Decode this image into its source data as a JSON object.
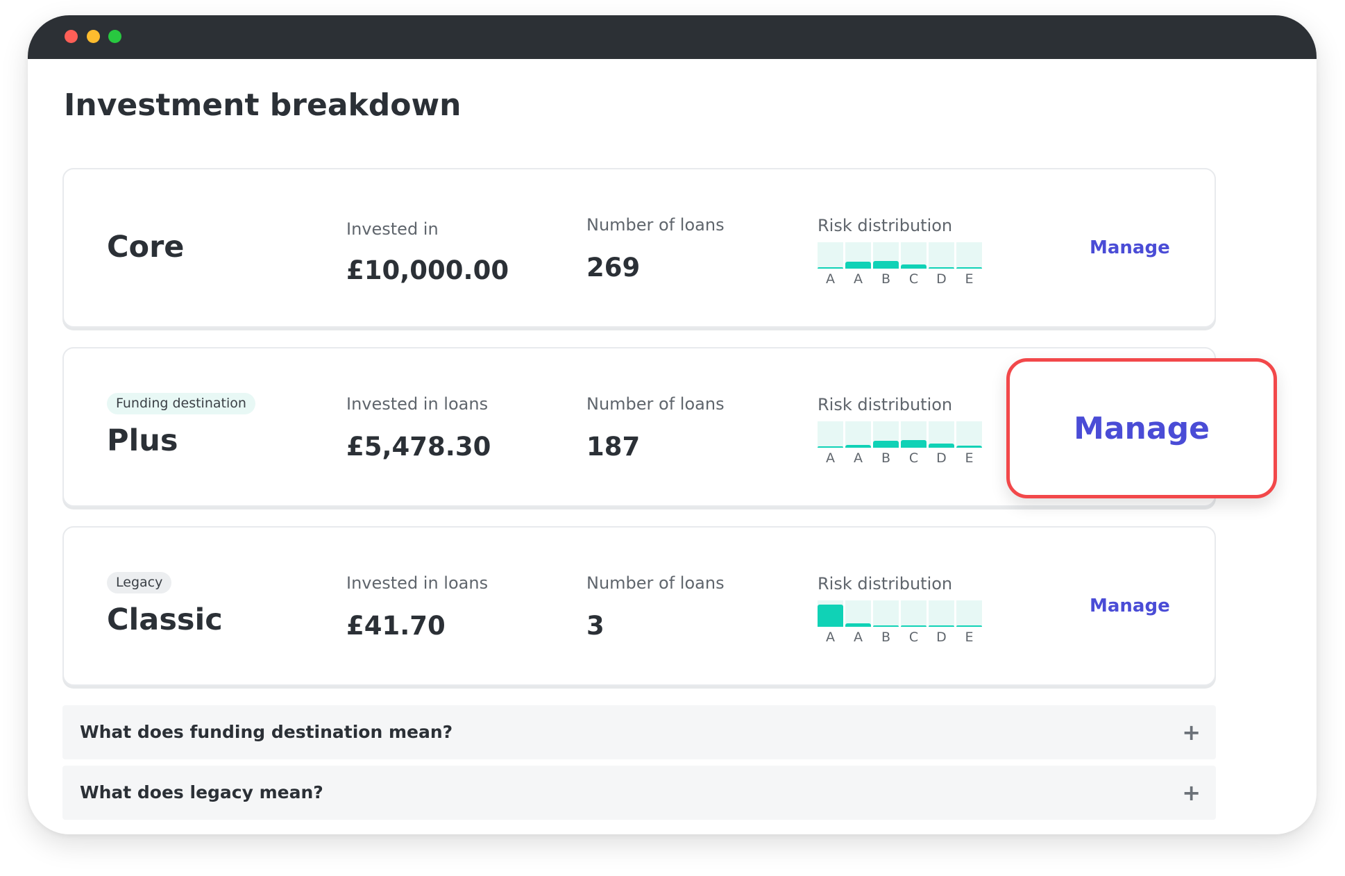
{
  "page": {
    "title": "Investment breakdown"
  },
  "cards": [
    {
      "name": "Core",
      "tag": "",
      "invested_label": "Invested in",
      "invested_value": "£10,000.00",
      "loans_label": "Number of loans",
      "loans_value": "269",
      "risk_label": "Risk distribution",
      "risk_letters": [
        "A",
        "A",
        "B",
        "C",
        "D",
        "E"
      ],
      "risk_levels": [
        0.05,
        0.25,
        0.3,
        0.15,
        0.05,
        0.05
      ],
      "manage_label": "Manage"
    },
    {
      "name": "Plus",
      "tag": "Funding destination",
      "invested_label": "Invested in loans",
      "invested_value": "£5,478.30",
      "loans_label": "Number of loans",
      "loans_value": "187",
      "risk_label": "Risk distribution",
      "risk_letters": [
        "A",
        "A",
        "B",
        "C",
        "D",
        "E"
      ],
      "risk_levels": [
        0.05,
        0.1,
        0.25,
        0.3,
        0.15,
        0.08
      ],
      "manage_label": "Manage"
    },
    {
      "name": "Classic",
      "tag": "Legacy",
      "invested_label": "Invested in loans",
      "invested_value": "£41.70",
      "loans_label": "Number of loans",
      "loans_value": "3",
      "risk_label": "Risk distribution",
      "risk_letters": [
        "A",
        "A",
        "B",
        "C",
        "D",
        "E"
      ],
      "risk_levels": [
        0.85,
        0.12,
        0.0,
        0.0,
        0.0,
        0.0
      ],
      "manage_label": "Manage"
    }
  ],
  "faq": [
    {
      "question": "What does funding destination mean?",
      "icon": "plus-icon"
    },
    {
      "question": "What does legacy mean?",
      "icon": "plus-icon"
    }
  ],
  "colors": {
    "accent": "#4a4cd6",
    "risk_fill": "#10d2b6",
    "risk_track": "#e7f8f5",
    "highlight_border": "#f2484a",
    "titlebar": "#2c3035"
  }
}
